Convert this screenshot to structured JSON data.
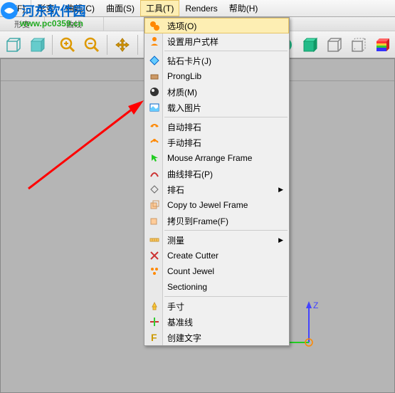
{
  "watermark": {
    "text": "河东软件园",
    "url": "www.pc0359.cn"
  },
  "menubar": {
    "items": [
      {
        "label": "件(F)"
      },
      {
        "label": "形变"
      },
      {
        "label": "曲线(C)"
      },
      {
        "label": "曲面(S)"
      },
      {
        "label": "工具(T)"
      },
      {
        "label": "Renders"
      },
      {
        "label": "帮助(H)"
      }
    ]
  },
  "toolbar_groups": {
    "g1": "形变",
    "g2": "曲线"
  },
  "dropdown": {
    "items": [
      {
        "label": "选项(O)",
        "active": true,
        "icon": "gears"
      },
      {
        "label": "设置用户式样",
        "icon": "user"
      },
      {
        "label": "钻石卡片(J)",
        "icon": "diamond"
      },
      {
        "label": "ProngLib",
        "icon": "prong"
      },
      {
        "label": "材质(M)",
        "icon": "material"
      },
      {
        "label": "载入图片",
        "icon": "image"
      },
      {
        "label": "自动排石",
        "icon": "auto"
      },
      {
        "label": "手动排石",
        "icon": "manual"
      },
      {
        "label": "Mouse Arrange Frame",
        "icon": "mouse"
      },
      {
        "label": "曲线排石(P)",
        "icon": "curve"
      },
      {
        "label": "排石",
        "icon": "gem",
        "submenu": true
      },
      {
        "label": "Copy to Jewel Frame",
        "icon": "copy"
      },
      {
        "label": "拷贝到Frame(F)",
        "icon": "copyf"
      },
      {
        "label": "测量",
        "icon": "measure",
        "submenu": true
      },
      {
        "label": "Create Cutter",
        "icon": "cutter"
      },
      {
        "label": "Count Jewel",
        "icon": "count"
      },
      {
        "label": "Sectioning",
        "icon": "section"
      },
      {
        "label": "手寸",
        "icon": "size"
      },
      {
        "label": "基准线",
        "icon": "baseline"
      },
      {
        "label": "创建文字",
        "icon": "text"
      }
    ]
  },
  "axes": {
    "z": "Z"
  }
}
